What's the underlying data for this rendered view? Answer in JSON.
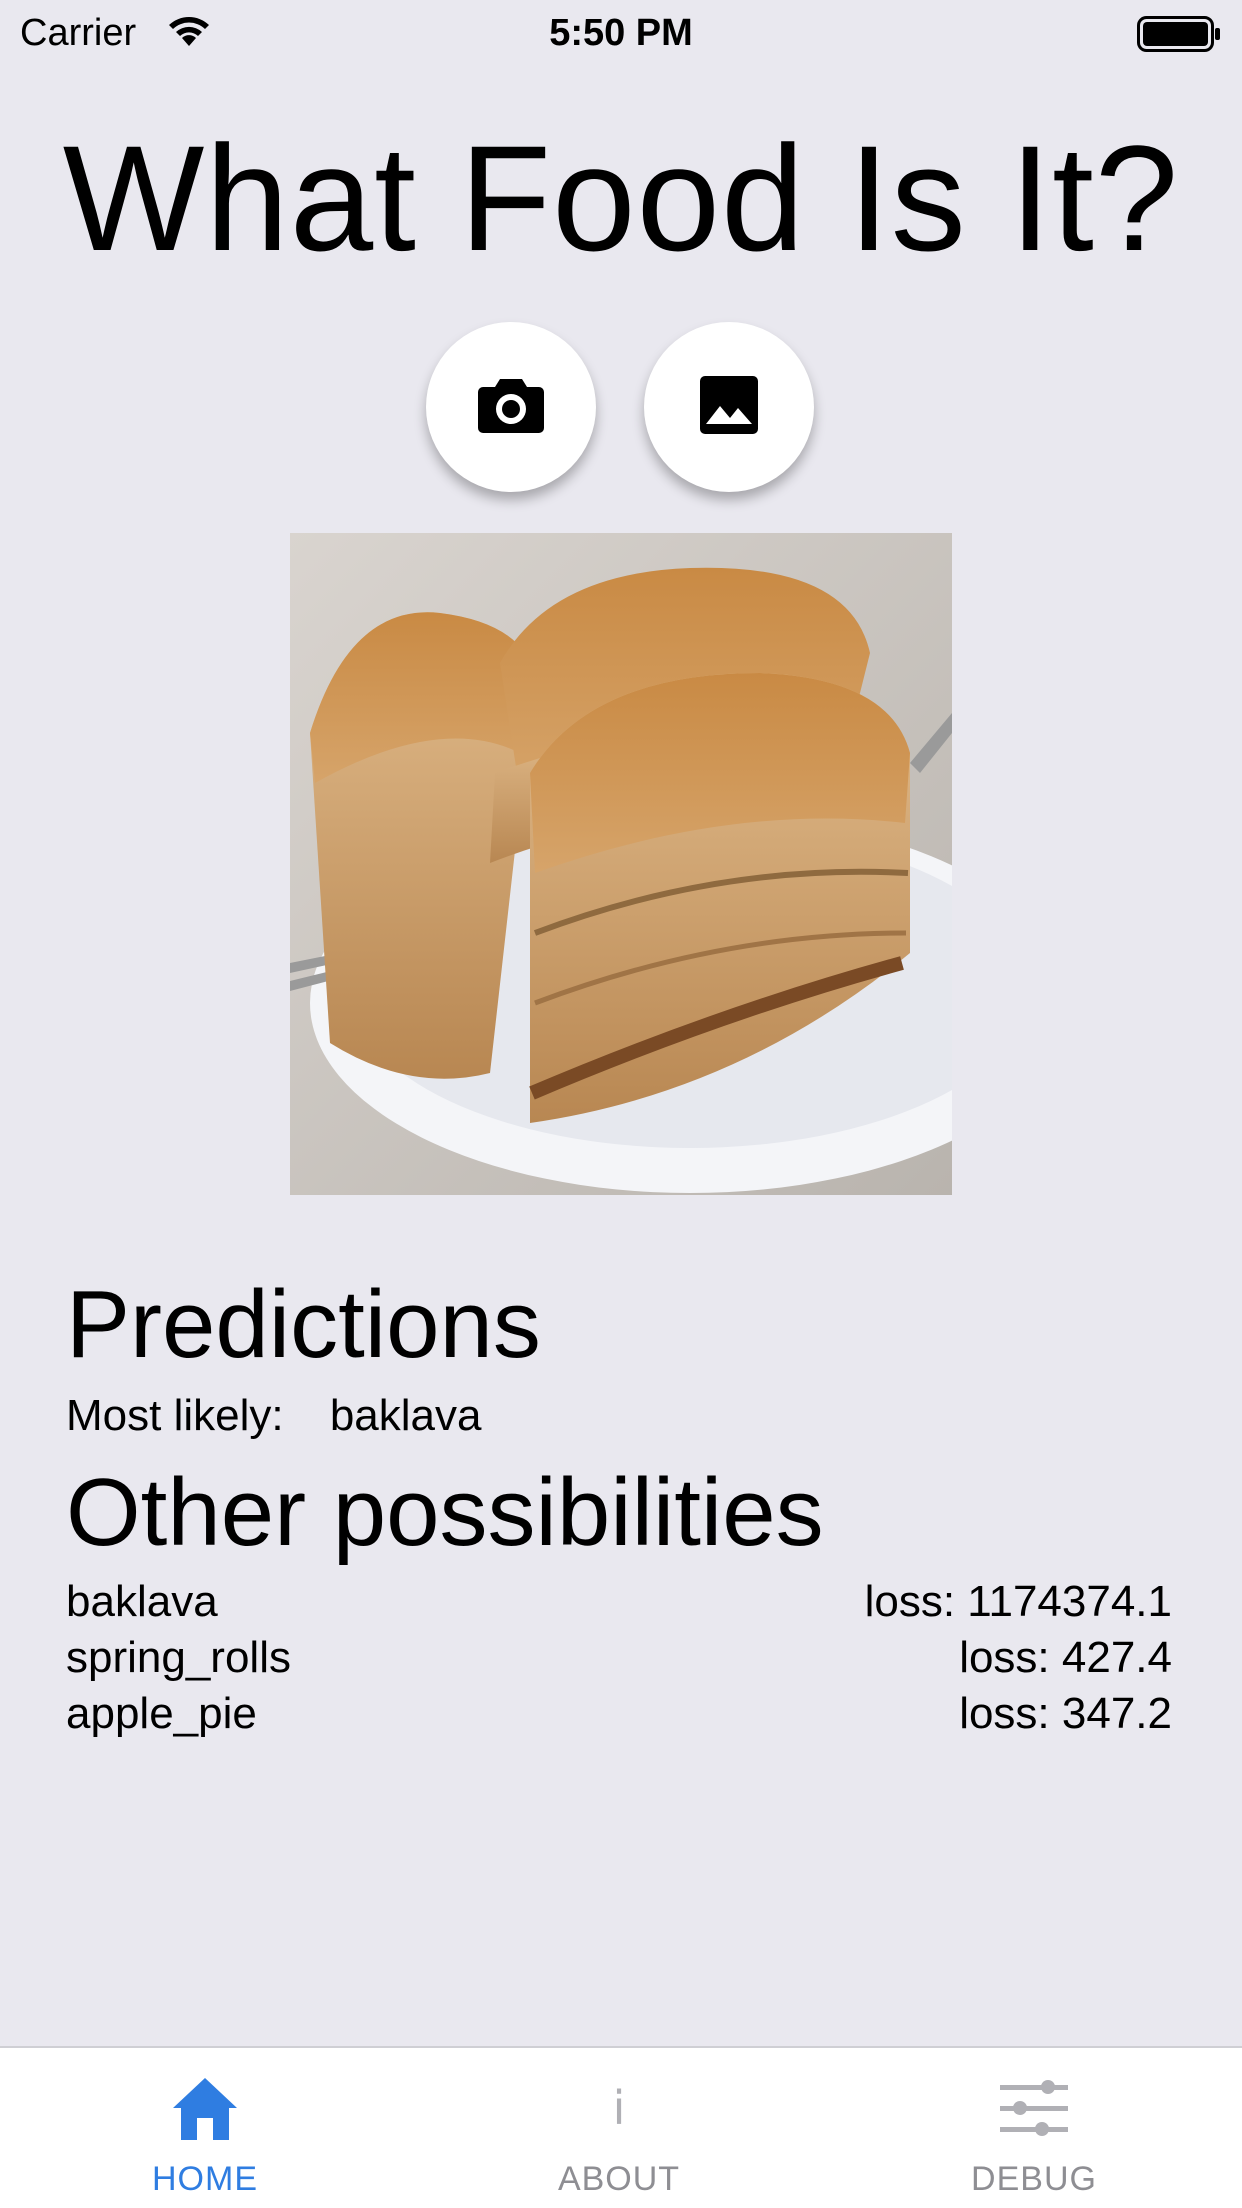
{
  "status_bar": {
    "carrier": "Carrier",
    "time": "5:50 PM"
  },
  "header": {
    "title": "What Food Is It?"
  },
  "actions": {
    "camera_icon": "camera-icon",
    "gallery_icon": "image-icon"
  },
  "photo": {
    "subject": "baklava-photo"
  },
  "predictions": {
    "heading": "Predictions",
    "most_likely_label": "Most likely:",
    "most_likely_value": "baklava",
    "other_heading": "Other possibilities",
    "items": [
      {
        "name": "baklava",
        "loss": "loss: 1174374.1"
      },
      {
        "name": "spring_rolls",
        "loss": "loss: 427.4"
      },
      {
        "name": "apple_pie",
        "loss": "loss: 347.2"
      }
    ]
  },
  "tab_bar": {
    "tabs": [
      {
        "label": "HOME",
        "icon": "home-icon",
        "active": true
      },
      {
        "label": "ABOUT",
        "icon": "info-icon",
        "glyph": "i",
        "active": false
      },
      {
        "label": "DEBUG",
        "icon": "sliders-icon",
        "active": false
      }
    ]
  },
  "colors": {
    "background": "#e9e8ef",
    "accent": "#2f7de1",
    "inactive": "#8e8e93"
  }
}
